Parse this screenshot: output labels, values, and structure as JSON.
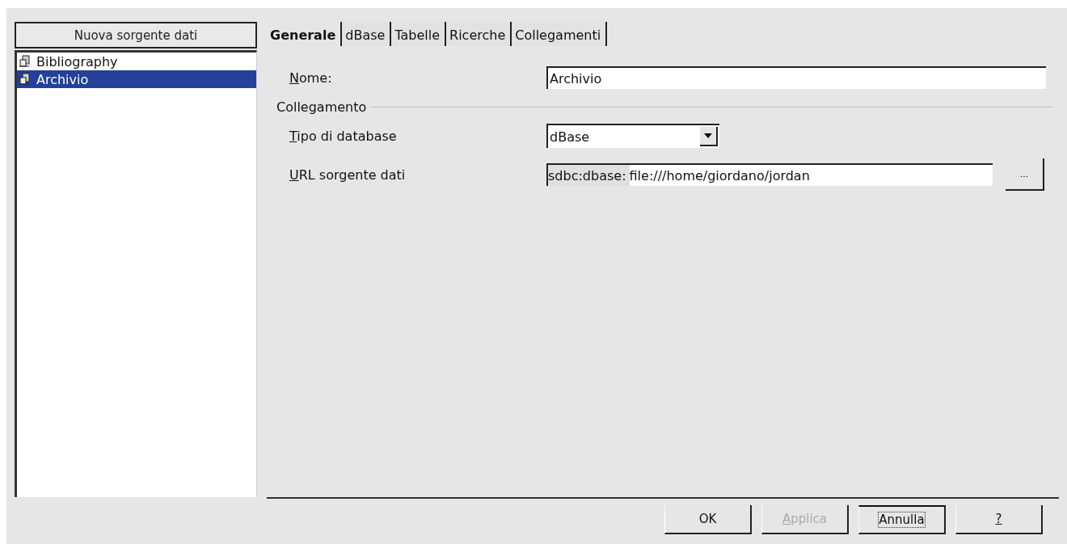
{
  "sidebar": {
    "new_button": "Nuova sorgente dati",
    "items": [
      {
        "label": "Bibliography",
        "selected": false
      },
      {
        "label": "Archivio",
        "selected": true
      }
    ]
  },
  "tabs": [
    {
      "label": "Generale",
      "selected": true
    },
    {
      "label": "dBase",
      "selected": false
    },
    {
      "label": "Tabelle",
      "selected": false
    },
    {
      "label": "Ricerche",
      "selected": false
    },
    {
      "label": "Collegamenti",
      "selected": false
    }
  ],
  "form": {
    "name_label": "Nome:",
    "name_value": "Archivio",
    "group_title": "Collegamento",
    "type_label": "Tipo di database",
    "type_value": "dBase",
    "url_label": "URL sorgente dati",
    "url_prefix": "sdbc:dbase:",
    "url_value": "file:///home/giordano/jordan",
    "browse_button": "..."
  },
  "buttons": [
    {
      "label": "OK",
      "disabled": false,
      "focused": false,
      "mnemonic": false
    },
    {
      "label": "Applica",
      "disabled": true,
      "focused": false,
      "mnemonic": true
    },
    {
      "label": "Annulla",
      "disabled": false,
      "focused": true,
      "mnemonic": false
    },
    {
      "label": "?",
      "disabled": false,
      "focused": false,
      "mnemonic": true
    }
  ]
}
